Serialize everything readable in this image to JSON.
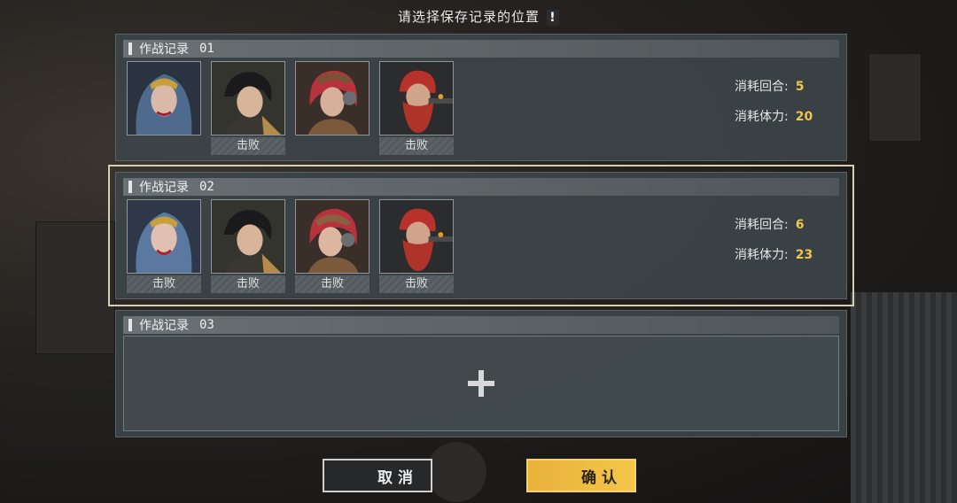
{
  "header": {
    "title": "请选择保存记录的位置",
    "alert_mark": "!"
  },
  "labels": {
    "defeat": "击败",
    "rounds": "消耗回合:",
    "stamina": "消耗体力:"
  },
  "records": [
    {
      "title": "作战记录",
      "number": "01",
      "characters": [
        {
          "icon": "blue-hair-woman-portrait",
          "defeated": false
        },
        {
          "icon": "dark-hair-man-portrait",
          "defeated": true
        },
        {
          "icon": "red-hair-headset-woman-portrait",
          "defeated": false
        },
        {
          "icon": "red-beard-man-portrait",
          "defeated": true
        }
      ],
      "rounds": "5",
      "stamina": "20"
    },
    {
      "title": "作战记录",
      "number": "02",
      "characters": [
        {
          "icon": "blue-hair-woman-portrait",
          "defeated": true
        },
        {
          "icon": "dark-hair-man-portrait",
          "defeated": true
        },
        {
          "icon": "red-hair-headset-woman-portrait",
          "defeated": true
        },
        {
          "icon": "red-beard-man-portrait",
          "defeated": true
        }
      ],
      "rounds": "6",
      "stamina": "23"
    },
    {
      "title": "作战记录",
      "number": "03",
      "empty": true
    }
  ],
  "buttons": {
    "cancel": "取消",
    "confirm": "确认"
  },
  "colors": {
    "accent": "#f1c54a",
    "selected_border": "#d7cfb5"
  }
}
